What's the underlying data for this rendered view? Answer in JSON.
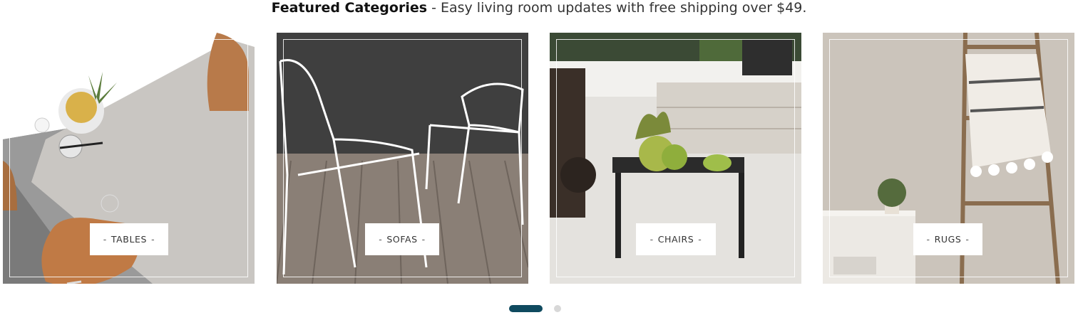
{
  "header": {
    "strong": "Featured Categories",
    "rest": " - Easy living room updates with free shipping over $49."
  },
  "categories": [
    {
      "label": "TABLES",
      "dash": "-"
    },
    {
      "label": "SOFAS",
      "dash": "-"
    },
    {
      "label": "CHAIRS",
      "dash": "-"
    },
    {
      "label": "RUGS",
      "dash": "-"
    }
  ],
  "carousel": {
    "active_slide": 1,
    "slide_count": 2,
    "active_color": "#0f4a5f",
    "inactive_color": "#d8d8d8"
  }
}
